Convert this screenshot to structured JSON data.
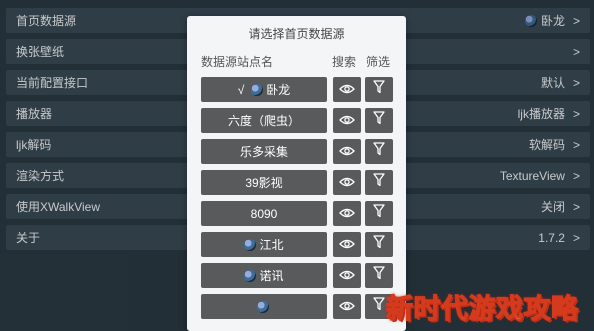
{
  "settings": [
    {
      "label": "首页数据源",
      "value": "卧龙",
      "has_logo": true
    },
    {
      "label": "换张壁纸",
      "value": ""
    },
    {
      "label": "当前配置接口",
      "value": "默认"
    },
    {
      "label": "播放器",
      "value": "ljk播放器"
    },
    {
      "label": "ljk解码",
      "value": "软解码"
    },
    {
      "label": "渲染方式",
      "value": "TextureView"
    },
    {
      "label": "使用XWalkView",
      "value": "关闭"
    },
    {
      "label": "关于",
      "value": "1.7.2"
    }
  ],
  "chevron": ">",
  "dialog": {
    "title": "请选择首页数据源",
    "col_name": "数据源站点名",
    "col_search": "搜索",
    "col_filter": "筛选",
    "sources": [
      {
        "name": "卧龙",
        "check": "√",
        "has_logo": true,
        "selected": true
      },
      {
        "name": "六度（爬虫）"
      },
      {
        "name": "乐多采集"
      },
      {
        "name": "39影视"
      },
      {
        "name": "8090"
      },
      {
        "name": "江北",
        "has_logo": true
      },
      {
        "name": "诺讯",
        "has_logo": true
      },
      {
        "name": "",
        "has_logo": true
      }
    ]
  },
  "watermark": "新时代游戏攻略"
}
